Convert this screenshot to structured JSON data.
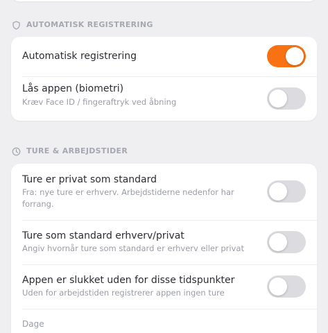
{
  "sections": {
    "automatic": {
      "title": "AUTOMATISK REGISTRERING",
      "icon": "shield-icon",
      "rows": [
        {
          "title": "Automatisk registrering",
          "subtitle": "",
          "toggle_on": true
        },
        {
          "title": "Lås appen (biometri)",
          "subtitle": "Kræv Face ID / fingeraftryk ved åbning",
          "toggle_on": false
        }
      ]
    },
    "trips": {
      "title": "TURE & ARBEJDSTIDER",
      "icon": "clock-icon",
      "rows": [
        {
          "title": "Ture er privat som standard",
          "subtitle": "Fra: nye ture er erhverv. Arbejdstiderne nedenfor har forrang.",
          "toggle_on": false
        },
        {
          "title": "Ture som standard erhverv/privat",
          "subtitle": "Angiv hvornår ture som standard er erhverv eller privat",
          "toggle_on": false
        },
        {
          "title": "Appen er slukket uden for disse tidspunkter",
          "subtitle": "Uden for arbejdstiden registrerer appen ingen ture",
          "toggle_on": false
        }
      ],
      "days_label": "Dage"
    }
  },
  "colors": {
    "accent": "#f87214",
    "toggle_off": "#dcdce0",
    "background": "#efeff1",
    "section_header": "#a6a8b1"
  }
}
